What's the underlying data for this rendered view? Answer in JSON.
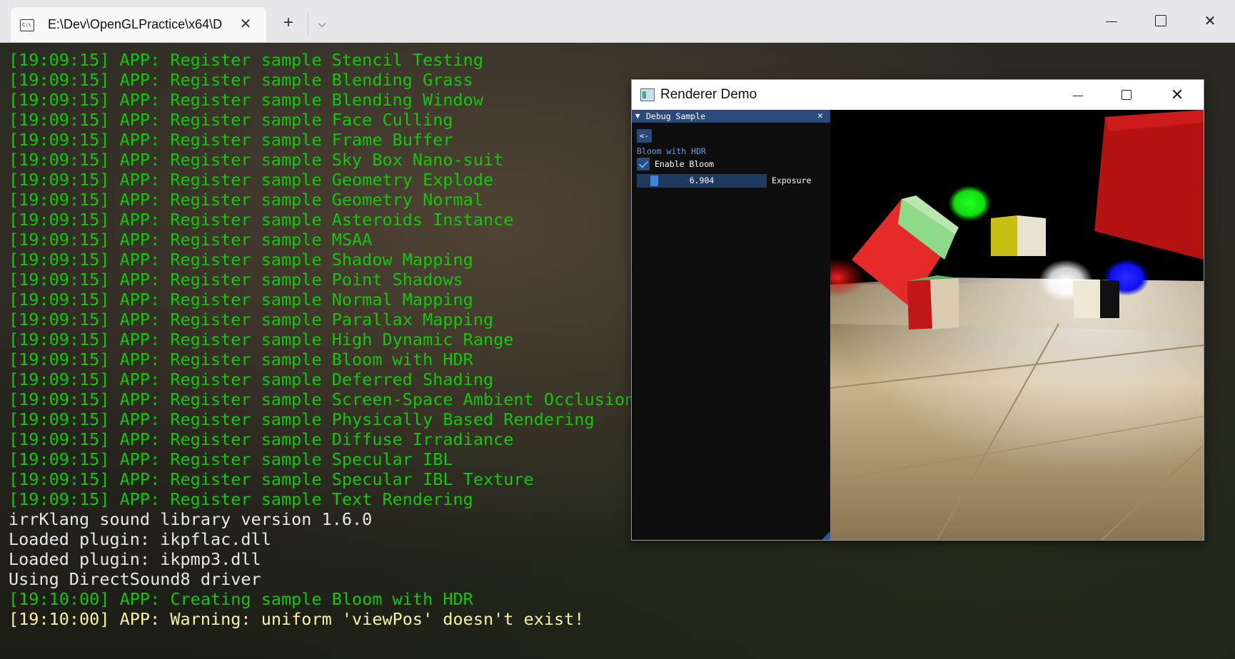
{
  "terminal": {
    "tab_title": "E:\\Dev\\OpenGLPractice\\x64\\D",
    "tab_icon": "C:\\",
    "new_tab_label": "+",
    "lines": [
      {
        "text": "[19:09:15] APP: Register sample Stencil Testing",
        "color": "green"
      },
      {
        "text": "[19:09:15] APP: Register sample Blending Grass",
        "color": "green"
      },
      {
        "text": "[19:09:15] APP: Register sample Blending Window",
        "color": "green"
      },
      {
        "text": "[19:09:15] APP: Register sample Face Culling",
        "color": "green"
      },
      {
        "text": "[19:09:15] APP: Register sample Frame Buffer",
        "color": "green"
      },
      {
        "text": "[19:09:15] APP: Register sample Sky Box Nano-suit",
        "color": "green"
      },
      {
        "text": "[19:09:15] APP: Register sample Geometry Explode",
        "color": "green"
      },
      {
        "text": "[19:09:15] APP: Register sample Geometry Normal",
        "color": "green"
      },
      {
        "text": "[19:09:15] APP: Register sample Asteroids Instance",
        "color": "green"
      },
      {
        "text": "[19:09:15] APP: Register sample MSAA",
        "color": "green"
      },
      {
        "text": "[19:09:15] APP: Register sample Shadow Mapping",
        "color": "green"
      },
      {
        "text": "[19:09:15] APP: Register sample Point Shadows",
        "color": "green"
      },
      {
        "text": "[19:09:15] APP: Register sample Normal Mapping",
        "color": "green"
      },
      {
        "text": "[19:09:15] APP: Register sample Parallax Mapping",
        "color": "green"
      },
      {
        "text": "[19:09:15] APP: Register sample High Dynamic Range",
        "color": "green"
      },
      {
        "text": "[19:09:15] APP: Register sample Bloom with HDR",
        "color": "green"
      },
      {
        "text": "[19:09:15] APP: Register sample Deferred Shading",
        "color": "green"
      },
      {
        "text": "[19:09:15] APP: Register sample Screen-Space Ambient Occlusion",
        "color": "green"
      },
      {
        "text": "[19:09:15] APP: Register sample Physically Based Rendering",
        "color": "green"
      },
      {
        "text": "[19:09:15] APP: Register sample Diffuse Irradiance",
        "color": "green"
      },
      {
        "text": "[19:09:15] APP: Register sample Specular IBL",
        "color": "green"
      },
      {
        "text": "[19:09:15] APP: Register sample Specular IBL Texture",
        "color": "green"
      },
      {
        "text": "[19:09:15] APP: Register sample Text Rendering",
        "color": "green"
      },
      {
        "text": "irrKlang sound library version 1.6.0",
        "color": "white"
      },
      {
        "text": "Loaded plugin: ikpflac.dll",
        "color": "white"
      },
      {
        "text": "Loaded plugin: ikpmp3.dll",
        "color": "white"
      },
      {
        "text": "Using DirectSound8 driver",
        "color": "white"
      },
      {
        "text": "[19:10:00] APP: Creating sample Bloom with HDR",
        "color": "green"
      },
      {
        "text": "[19:10:00] APP: Warning: uniform 'viewPos' doesn't exist!",
        "color": "yellow"
      }
    ]
  },
  "renderer": {
    "title": "Renderer Demo",
    "panel": {
      "title": "Debug Sample",
      "back_label": "<-",
      "sample_name": "Bloom with HDR",
      "checkbox_label": "Enable Bloom",
      "checkbox_checked": true,
      "slider_value_text": "6.904",
      "slider_label": "Exposure",
      "slider_fraction": 0.1
    }
  },
  "colors": {
    "log_green": "#16c60c",
    "log_white": "#e8e8e8",
    "log_yellow": "#f9f1a5",
    "imgui_header": "#294a7a",
    "imgui_accent": "#3d85e0"
  }
}
